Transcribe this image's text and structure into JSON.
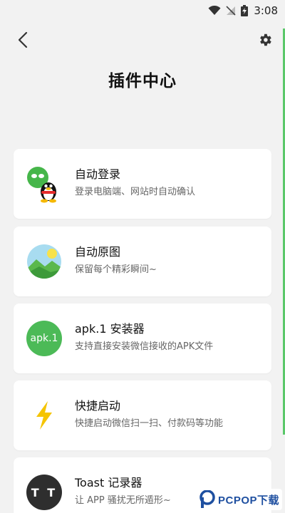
{
  "status": {
    "time": "3:08"
  },
  "header": {
    "title": "插件中心"
  },
  "plugins": [
    {
      "title": "自动登录",
      "desc": "登录电脑端、网站时自动确认",
      "icon": "wechat-qq-icon"
    },
    {
      "title": "自动原图",
      "desc": "保留每个精彩瞬间~",
      "icon": "landscape-photo-icon"
    },
    {
      "title": "apk.1 安装器",
      "desc": "支持直接安装微信接收的APK文件",
      "icon": "apk-installer-icon",
      "icon_text": "apk.1"
    },
    {
      "title": "快捷启动",
      "desc": "快捷启动微信扫一扫、付款码等功能",
      "icon": "lightning-icon"
    },
    {
      "title": "Toast 记录器",
      "desc": "让 APP 骚扰无所遁形~",
      "icon": "toast-recorder-icon",
      "icon_text": "T T"
    }
  ],
  "watermark": {
    "text": "PCPOP下载"
  },
  "colors": {
    "background": "#f2f2f2",
    "card": "#ffffff",
    "accent_green": "#4cba57",
    "lightning": "#f5c400",
    "toast_icon": "#2e2e2e"
  }
}
